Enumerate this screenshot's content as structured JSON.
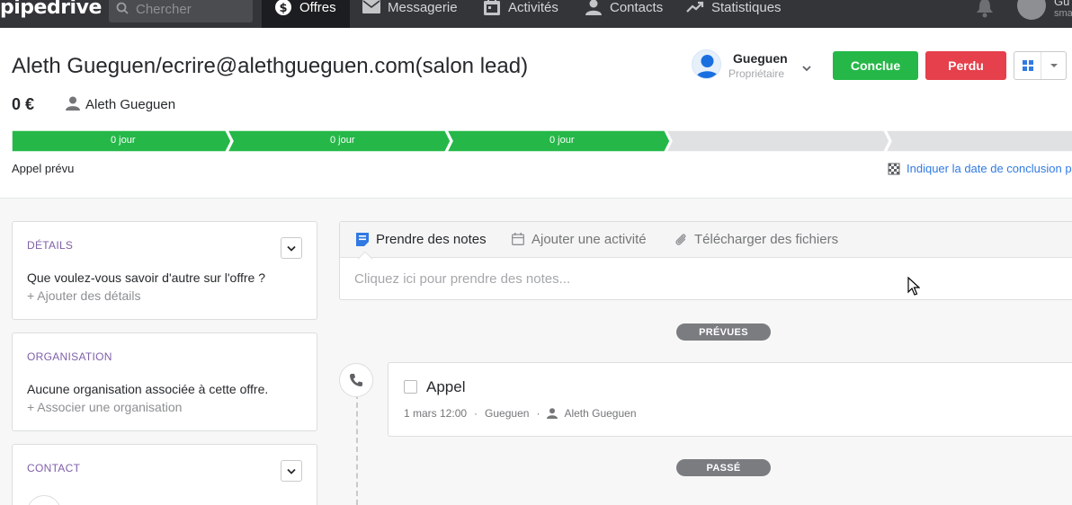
{
  "app": {
    "logo": "pipedrive"
  },
  "topnav": {
    "search_placeholder": "Chercher",
    "items": [
      {
        "label": "Offres",
        "icon": "dollar-icon",
        "active": true
      },
      {
        "label": "Messagerie",
        "icon": "mail-icon"
      },
      {
        "label": "Activités",
        "icon": "calendar-icon"
      },
      {
        "label": "Contacts",
        "icon": "person-icon"
      },
      {
        "label": "Statistiques",
        "icon": "trend-icon"
      }
    ],
    "user_name": "Gu",
    "user_sub": "sma"
  },
  "deal": {
    "title": "Aleth Gueguen/ecrire@alethgueguen.com(salon lead)",
    "value": "0 €",
    "person": "Aleth Gueguen",
    "owner_name": "Gueguen",
    "owner_role": "Propriétaire",
    "won_label": "Conclue",
    "lost_label": "Perdu"
  },
  "pipeline": {
    "stages": [
      {
        "label": "0 jour",
        "done": true
      },
      {
        "label": "0 jour",
        "done": true
      },
      {
        "label": "0 jour",
        "done": true
      },
      {
        "label": "",
        "done": false
      },
      {
        "label": "",
        "done": false
      }
    ],
    "current_stage": "Appel prévu",
    "close_date_link": "Indiquer la date de conclusion p"
  },
  "sidebar": {
    "details": {
      "title": "DÉTAILS",
      "question": "Que voulez-vous savoir d'autre sur l'offre ?",
      "add_link": "+ Ajouter des détails"
    },
    "organisation": {
      "title": "ORGANISATION",
      "text": "Aucune organisation associée à cette offre.",
      "add_link": "+ Associer une organisation"
    },
    "contact": {
      "title": "CONTACT"
    }
  },
  "composer": {
    "tabs": [
      {
        "label": "Prendre des notes",
        "icon": "note-icon",
        "active": true
      },
      {
        "label": "Ajouter une activité",
        "icon": "calendar-icon"
      },
      {
        "label": "Télécharger des fichiers",
        "icon": "paperclip-icon"
      }
    ],
    "placeholder": "Cliquez ici pour prendre des notes..."
  },
  "timeline": {
    "planned_label": "PRÉVUES",
    "past_label": "PASSÉ",
    "activity": {
      "title": "Appel",
      "date": "1 mars 12:00",
      "owner": "Gueguen",
      "person": "Aleth Gueguen"
    }
  },
  "colors": {
    "nav_bg": "#333539",
    "won": "#25b848",
    "lost": "#e5404b",
    "link": "#317ae2",
    "section_title": "#7f5fa8",
    "stage_done": "#25b848",
    "stage_todo": "#e0e1e2"
  }
}
